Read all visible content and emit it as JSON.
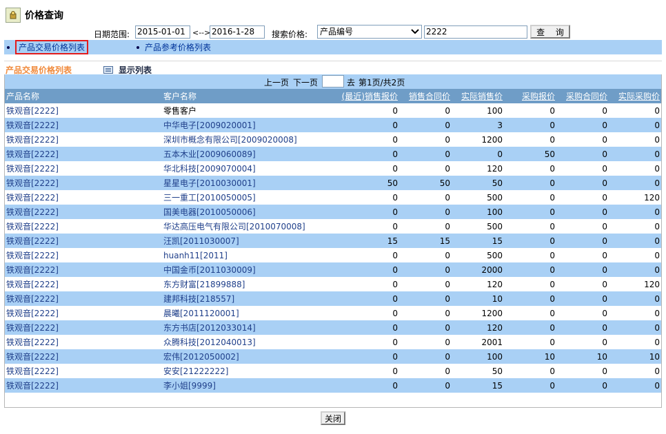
{
  "window": {
    "title": "价格查询"
  },
  "search": {
    "date_label": "日期范围:",
    "date_from": "2015-01-01",
    "date_sep": "<-->",
    "date_to": "2016-1-28",
    "price_label": "搜索价格:",
    "field_selected": "产品编号",
    "keyword": "2222",
    "query_button": "查  询"
  },
  "tabs": [
    {
      "label": "产品交易价格列表",
      "active": true
    },
    {
      "label": "产品参考价格列表",
      "active": false
    }
  ],
  "section": {
    "title": "产品交易价格列表",
    "show_list": "显示列表"
  },
  "pager": {
    "prev": "上一页",
    "next": "下一页",
    "goto": "去",
    "status": "第1页/共2页",
    "page_input": ""
  },
  "table": {
    "headers": [
      "产品名称",
      "客户名称",
      "(最近)销售报价",
      "销售合同价",
      "实际销售价",
      "采购报价",
      "采购合同价",
      "实际采购价"
    ],
    "rows": [
      [
        "铁观音[2222]",
        "零售客户",
        "0",
        "0",
        "100",
        "0",
        "0",
        "0"
      ],
      [
        "铁观音[2222]",
        "中华电子[2009020001]",
        "0",
        "0",
        "3",
        "0",
        "0",
        "0"
      ],
      [
        "铁观音[2222]",
        "深圳市概念有限公司[2009020008]",
        "0",
        "0",
        "1200",
        "0",
        "0",
        "0"
      ],
      [
        "铁观音[2222]",
        "五本木业[2009060089]",
        "0",
        "0",
        "0",
        "50",
        "0",
        "0"
      ],
      [
        "铁观音[2222]",
        "华北科技[2009070004]",
        "0",
        "0",
        "120",
        "0",
        "0",
        "0"
      ],
      [
        "铁观音[2222]",
        "星星电子[2010030001]",
        "50",
        "50",
        "50",
        "0",
        "0",
        "0"
      ],
      [
        "铁观音[2222]",
        "三一重工[2010050005]",
        "0",
        "0",
        "500",
        "0",
        "0",
        "120"
      ],
      [
        "铁观音[2222]",
        "国美电器[2010050006]",
        "0",
        "0",
        "100",
        "0",
        "0",
        "0"
      ],
      [
        "铁观音[2222]",
        "华达高压电气有限公司[2010070008]",
        "0",
        "0",
        "500",
        "0",
        "0",
        "0"
      ],
      [
        "铁观音[2222]",
        "汪凯[2011030007]",
        "15",
        "15",
        "15",
        "0",
        "0",
        "0"
      ],
      [
        "铁观音[2222]",
        "huanh11[2011]",
        "0",
        "0",
        "500",
        "0",
        "0",
        "0"
      ],
      [
        "铁观音[2222]",
        "中国金币[2011030009]",
        "0",
        "0",
        "2000",
        "0",
        "0",
        "0"
      ],
      [
        "铁观音[2222]",
        "东方财富[21899888]",
        "0",
        "0",
        "120",
        "0",
        "0",
        "120"
      ],
      [
        "铁观音[2222]",
        "建邦科技[218557]",
        "0",
        "0",
        "10",
        "0",
        "0",
        "0"
      ],
      [
        "铁观音[2222]",
        "晨曦[2011120001]",
        "0",
        "0",
        "1200",
        "0",
        "0",
        "0"
      ],
      [
        "铁观音[2222]",
        "东方书店[2012033014]",
        "0",
        "0",
        "120",
        "0",
        "0",
        "0"
      ],
      [
        "铁观音[2222]",
        "众腾科技[2012040013]",
        "0",
        "0",
        "2001",
        "0",
        "0",
        "0"
      ],
      [
        "铁观音[2222]",
        "宏伟[2012050002]",
        "0",
        "0",
        "100",
        "10",
        "10",
        "10"
      ],
      [
        "铁观音[2222]",
        "安安[21222222]",
        "0",
        "0",
        "50",
        "0",
        "0",
        "0"
      ],
      [
        "铁观音[2222]",
        "李小姐[9999]",
        "0",
        "0",
        "15",
        "0",
        "0",
        "0"
      ]
    ]
  },
  "footer": {
    "close_button": "关闭"
  },
  "colors": {
    "row_alt": "#a9d0f5",
    "header_bg": "#6f9dc7",
    "section_title": "#f08a3c",
    "active_tab_border": "#e31b1b"
  }
}
